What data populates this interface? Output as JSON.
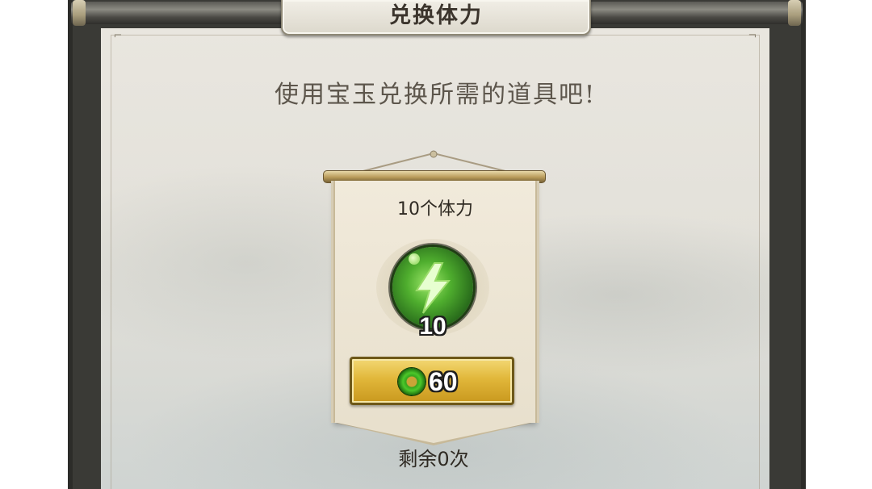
{
  "header": {
    "title": "兑换体力"
  },
  "main": {
    "subtitle": "使用宝玉兑换所需的道具吧!",
    "item": {
      "name": "10个体力",
      "icon": "stamina-orb-icon",
      "quantity": "10",
      "price": "60",
      "currency_icon": "jade-icon",
      "remaining": "剩余0次"
    }
  },
  "colors": {
    "button_gold": "#e1b73a",
    "orb_green": "#4fae2e",
    "frame_dark": "#3a3a36"
  }
}
